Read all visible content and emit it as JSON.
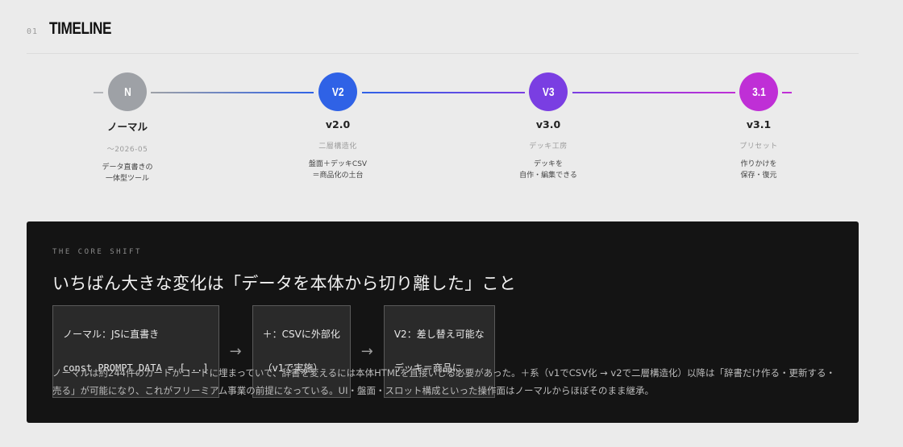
{
  "section": {
    "number": "01",
    "title": "TIMELINE"
  },
  "timeline": {
    "nodes": [
      {
        "badge": "N",
        "name": "ノーマル",
        "date": "〜2026-05",
        "desc": "データ直書きの\n一体型ツール",
        "color": "#9ea1a6"
      },
      {
        "badge": "V2",
        "name": "v2.0",
        "date": "二層構造化",
        "desc": "盤面＋デッキCSV\n＝商品化の土台",
        "color": "#2f62e6"
      },
      {
        "badge": "V3",
        "name": "v3.0",
        "date": "デッキ工房",
        "desc": "デッキを\n自作・編集できる",
        "color": "#7a3ee2"
      },
      {
        "badge": "3.1",
        "name": "v3.1",
        "date": "プリセット",
        "desc": "作りかけを\n保存・復元",
        "color": "#bf2fd6"
      }
    ]
  },
  "core_shift": {
    "kicker": "THE CORE SHIFT",
    "headline": "いちばん大きな変化は「データを本体から切り離した」こと",
    "flow": [
      {
        "line1": "ノーマル：JSに直書き",
        "line2": "const PROMPT_DATA = [...]"
      },
      {
        "line1": "＋：CSVに外部化",
        "line2": "（v1で実施）"
      },
      {
        "line1": "V2：差し替え可能な",
        "line2": "デッキ＝商品に"
      }
    ],
    "arrow": "→",
    "body": "ノーマルは約244件のカードがコードに埋まっていて、辞書を変えるには本体HTMLを直接いじる必要があった。＋系（v1でCSV化 → v2で二層構造化）以降は「辞書だけ作る・更新する・売る」が可能になり、これがフリーミアム事業の前提になっている。UI・盤面・スロット構成といった操作面はノーマルからほぼそのまま継承。"
  }
}
